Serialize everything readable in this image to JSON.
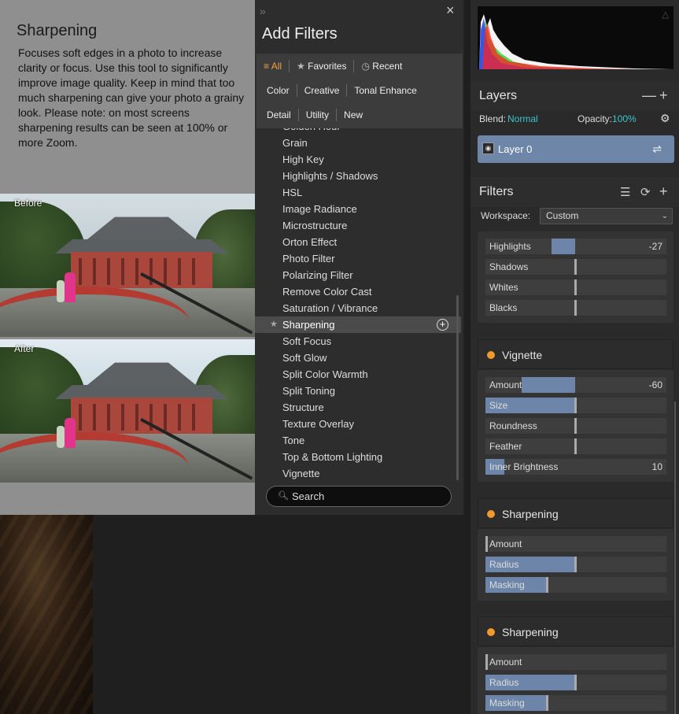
{
  "preview": {
    "title": "Sharpening",
    "description": "Focuses soft edges in a photo to increase clarity or focus. Use this tool to significantly improve image quality. Keep in mind that too much sharpening can give your photo a grainy look. Please note: on most screens sharpening results can be seen at 100% or more Zoom.",
    "before_label": "Before",
    "after_label": "After"
  },
  "add_filters": {
    "title": "Add Filters",
    "close_glyph": "×",
    "collapse_glyph": "»",
    "tabs_row1": [
      "All",
      "Favorites",
      "Recent"
    ],
    "tabs_row2": [
      "Color",
      "Creative",
      "Tonal Enhance"
    ],
    "tabs_row3": [
      "Detail",
      "Utility",
      "New"
    ],
    "list": [
      "Golden Hour",
      "Grain",
      "High Key",
      "Highlights / Shadows",
      "HSL",
      "Image Radiance",
      "Microstructure",
      "Orton Effect",
      "Photo Filter",
      "Polarizing Filter",
      "Remove Color Cast",
      "Saturation / Vibrance",
      "Sharpening",
      "Soft Focus",
      "Soft Glow",
      "Split Color Warmth",
      "Split Toning",
      "Structure",
      "Texture Overlay",
      "Tone",
      "Top & Bottom Lighting",
      "Vignette"
    ],
    "selected": "Sharpening",
    "search_placeholder": "Search"
  },
  "layers": {
    "title": "Layers",
    "blend_label": "Blend:",
    "blend_value": "Normal",
    "opacity_label": "Opacity:",
    "opacity_value": "100%",
    "layer_name": "Layer 0"
  },
  "filters": {
    "title": "Filters",
    "workspace_label": "Workspace:",
    "workspace_value": "Custom",
    "tone_sliders": [
      {
        "label": "Highlights",
        "value": "-27"
      },
      {
        "label": "Shadows",
        "value": ""
      },
      {
        "label": "Whites",
        "value": ""
      },
      {
        "label": "Blacks",
        "value": ""
      }
    ],
    "vignette": {
      "name": "Vignette",
      "sliders": [
        {
          "label": "Amount",
          "value": "-60"
        },
        {
          "label": "Size",
          "value": ""
        },
        {
          "label": "Roundness",
          "value": ""
        },
        {
          "label": "Feather",
          "value": ""
        },
        {
          "label": "Inner Brightness",
          "value": "10"
        }
      ]
    },
    "sharpening1": {
      "name": "Sharpening",
      "sliders": [
        {
          "label": "Amount",
          "value": ""
        },
        {
          "label": "Radius",
          "value": ""
        },
        {
          "label": "Masking",
          "value": ""
        }
      ]
    },
    "sharpening2": {
      "name": "Sharpening",
      "sliders": [
        {
          "label": "Amount",
          "value": ""
        },
        {
          "label": "Radius",
          "value": ""
        },
        {
          "label": "Masking",
          "value": ""
        }
      ]
    }
  },
  "colors": {
    "accent": "#f0a23c",
    "teal": "#3cc4c8",
    "slider_fill": "#6d85a8",
    "dot": "#f09a2b"
  }
}
